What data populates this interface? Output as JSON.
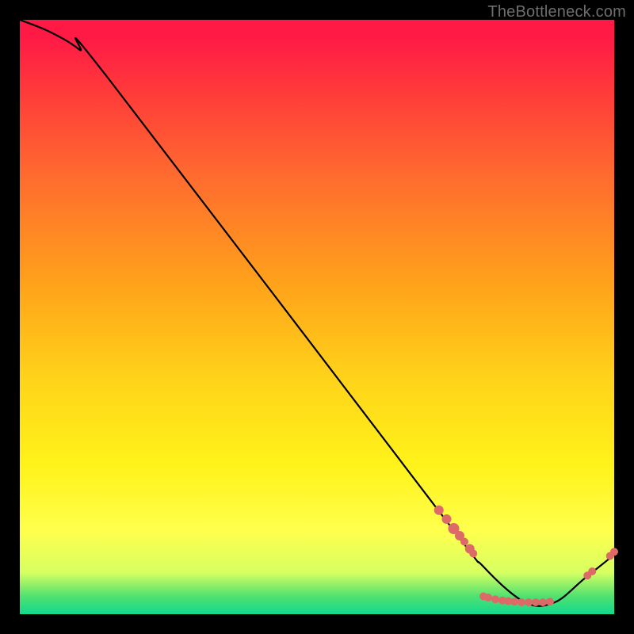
{
  "credit": "TheBottleneck.com",
  "chart_data": {
    "type": "line",
    "title": "",
    "xlabel": "",
    "ylabel": "",
    "xlim": [
      0,
      100
    ],
    "ylim": [
      0,
      100
    ],
    "grid": false,
    "legend": false,
    "series": [
      {
        "name": "bottleneck-curve",
        "x": [
          0,
          5,
          10,
          15,
          70,
          78,
          85,
          90,
          95,
          100
        ],
        "y": [
          100,
          98,
          95,
          90,
          18,
          8,
          2,
          2,
          6,
          10
        ]
      }
    ],
    "markers": [
      {
        "name": "red-dots",
        "color": "#de6a68",
        "points": [
          {
            "x": 70.5,
            "y": 17.5,
            "r": 6
          },
          {
            "x": 71.8,
            "y": 16.0,
            "r": 6
          },
          {
            "x": 73.0,
            "y": 14.4,
            "r": 7
          },
          {
            "x": 74.0,
            "y": 13.2,
            "r": 6
          },
          {
            "x": 74.8,
            "y": 12.2,
            "r": 5
          },
          {
            "x": 75.7,
            "y": 11.0,
            "r": 6
          },
          {
            "x": 76.3,
            "y": 10.2,
            "r": 5
          },
          {
            "x": 78.0,
            "y": 3.0,
            "r": 5
          },
          {
            "x": 78.8,
            "y": 2.8,
            "r": 5
          },
          {
            "x": 80.0,
            "y": 2.5,
            "r": 5
          },
          {
            "x": 81.2,
            "y": 2.3,
            "r": 5
          },
          {
            "x": 82.2,
            "y": 2.2,
            "r": 5
          },
          {
            "x": 83.2,
            "y": 2.1,
            "r": 5
          },
          {
            "x": 84.4,
            "y": 2.0,
            "r": 5
          },
          {
            "x": 85.6,
            "y": 2.0,
            "r": 5
          },
          {
            "x": 86.8,
            "y": 2.0,
            "r": 5
          },
          {
            "x": 88.0,
            "y": 2.0,
            "r": 5
          },
          {
            "x": 89.2,
            "y": 2.1,
            "r": 5
          },
          {
            "x": 95.5,
            "y": 6.5,
            "r": 5
          },
          {
            "x": 96.3,
            "y": 7.2,
            "r": 5
          },
          {
            "x": 99.3,
            "y": 9.8,
            "r": 5
          },
          {
            "x": 100.0,
            "y": 10.5,
            "r": 5
          }
        ]
      }
    ]
  }
}
